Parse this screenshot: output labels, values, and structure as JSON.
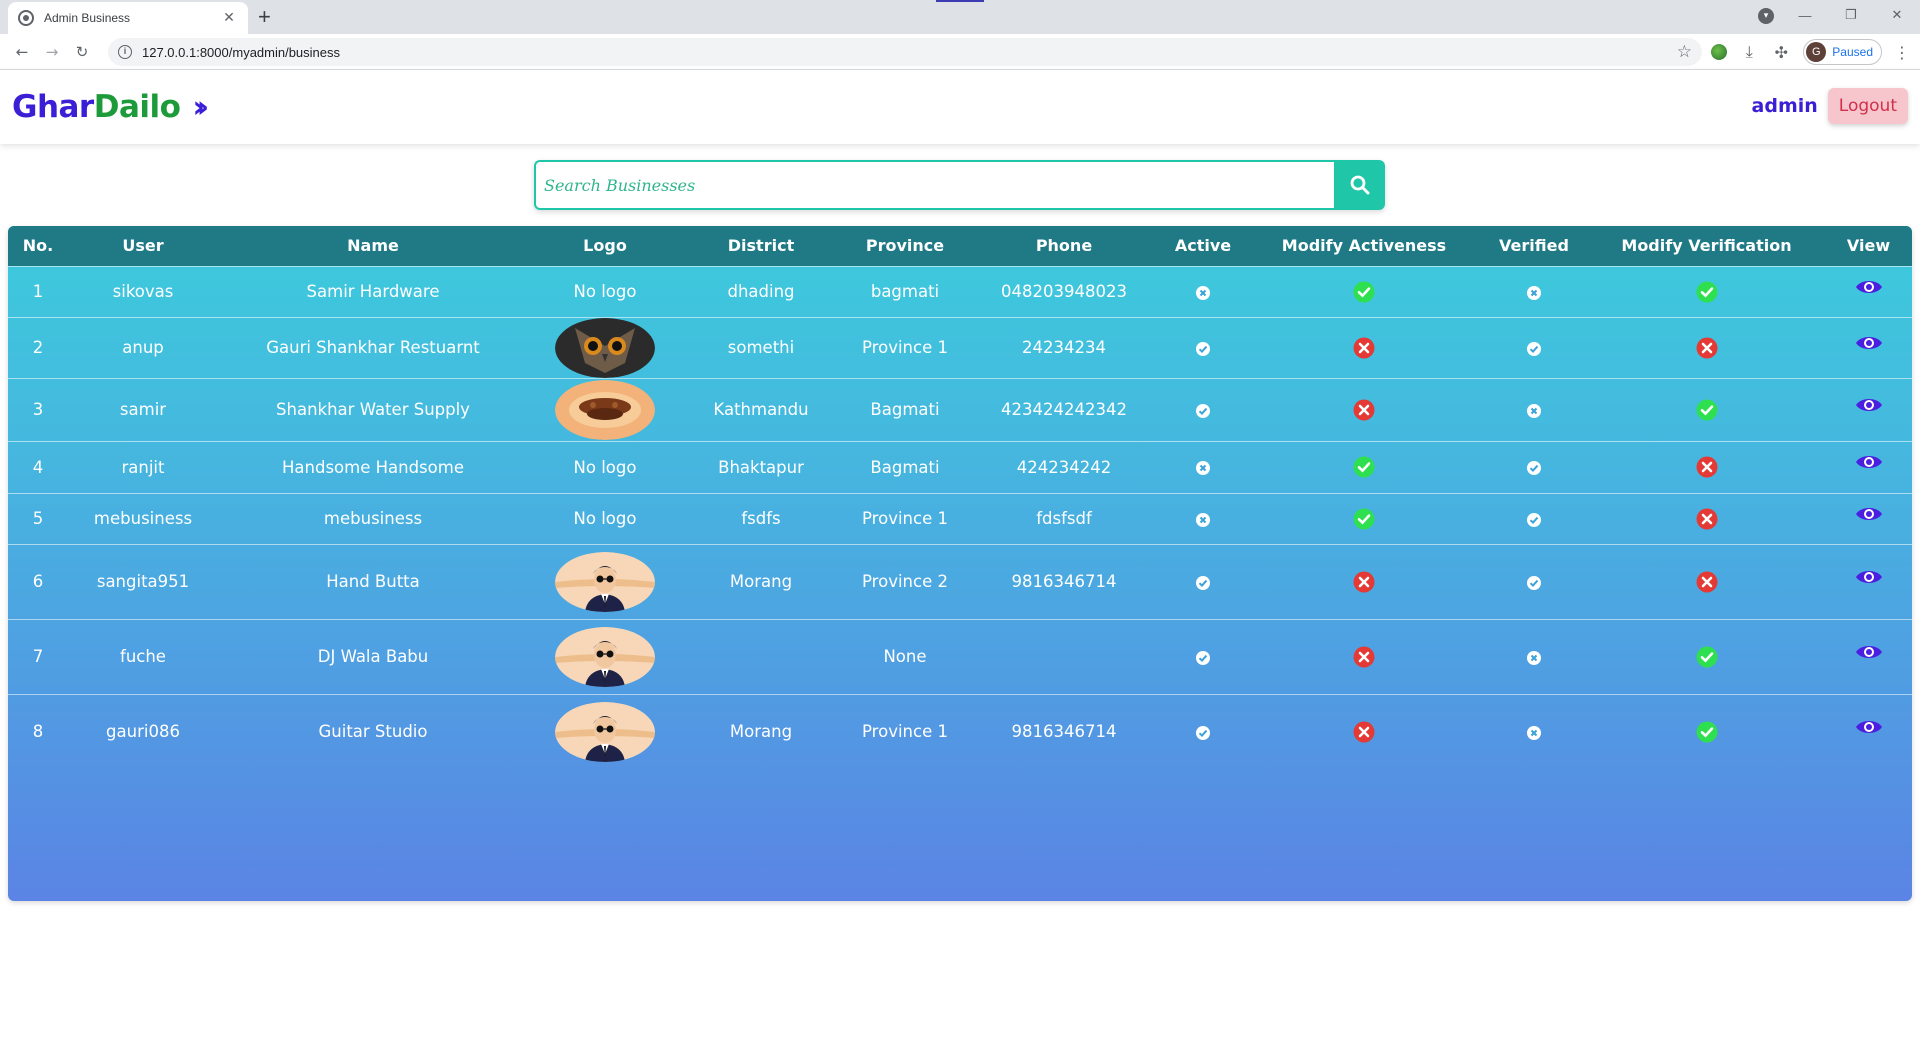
{
  "browser": {
    "tab_title": "Admin Business",
    "url": "127.0.0.1:8000/myadmin/business",
    "profile_initial": "G",
    "profile_status": "Paused"
  },
  "navbar": {
    "brand_part1": "Ghar",
    "brand_part2": "Dailo",
    "brand_part1_color": "#3a1fd6",
    "brand_part2_color": "#1d9b3a",
    "username": "admin",
    "logout_label": "Logout"
  },
  "search": {
    "placeholder": "Search Businesses"
  },
  "table": {
    "columns": [
      "No.",
      "User",
      "Name",
      "Logo",
      "District",
      "Province",
      "Phone",
      "Active",
      "Modify Activeness",
      "Verified",
      "Modify Verification",
      "View"
    ],
    "rows": [
      {
        "no": "1",
        "user": "sikovas",
        "name": "Samir Hardware",
        "logo": "No logo",
        "logo_image": "",
        "district": "dhading",
        "province": "bagmati",
        "phone": "048203948023",
        "active": false,
        "modify_activeness": "activate",
        "verified": false,
        "modify_verification": "verify"
      },
      {
        "no": "2",
        "user": "anup",
        "name": "Gauri Shankhar Restuarnt",
        "logo": "",
        "logo_image": "owl",
        "district": "somethi",
        "province": "Province 1",
        "phone": "24234234",
        "active": true,
        "modify_activeness": "deactivate",
        "verified": true,
        "modify_verification": "unverify"
      },
      {
        "no": "3",
        "user": "samir",
        "name": "Shankhar Water Supply",
        "logo": "",
        "logo_image": "food",
        "district": "Kathmandu",
        "province": "Bagmati",
        "phone": "423424242342",
        "active": true,
        "modify_activeness": "deactivate",
        "verified": false,
        "modify_verification": "verify"
      },
      {
        "no": "4",
        "user": "ranjit",
        "name": "Handsome Handsome",
        "logo": "No logo",
        "logo_image": "",
        "district": "Bhaktapur",
        "province": "Bagmati",
        "phone": "424234242",
        "active": false,
        "modify_activeness": "activate",
        "verified": true,
        "modify_verification": "unverify"
      },
      {
        "no": "5",
        "user": "mebusiness",
        "name": "mebusiness",
        "logo": "No logo",
        "logo_image": "",
        "district": "fsdfs",
        "province": "Province 1",
        "phone": "fdsfsdf",
        "active": false,
        "modify_activeness": "activate",
        "verified": true,
        "modify_verification": "unverify"
      },
      {
        "no": "6",
        "user": "sangita951",
        "name": "Hand Butta",
        "logo": "",
        "logo_image": "avatar",
        "district": "Morang",
        "province": "Province 2",
        "phone": "9816346714",
        "active": true,
        "modify_activeness": "deactivate",
        "verified": true,
        "modify_verification": "unverify"
      },
      {
        "no": "7",
        "user": "fuche",
        "name": "DJ Wala Babu",
        "logo": "",
        "logo_image": "avatar",
        "district": "",
        "province": "None",
        "phone": "",
        "active": true,
        "modify_activeness": "deactivate",
        "verified": false,
        "modify_verification": "verify"
      },
      {
        "no": "8",
        "user": "gauri086",
        "name": "Guitar Studio",
        "logo": "",
        "logo_image": "avatar",
        "district": "Morang",
        "province": "Province 1",
        "phone": "9816346714",
        "active": true,
        "modify_activeness": "deactivate",
        "verified": false,
        "modify_verification": "verify"
      }
    ]
  },
  "colors": {
    "header_bg": "#1f7a86",
    "accent_teal": "#1fc6a8",
    "ok_green": "#2ee04f",
    "danger_red": "#e53935",
    "eye_blue": "#4a1fe0"
  }
}
